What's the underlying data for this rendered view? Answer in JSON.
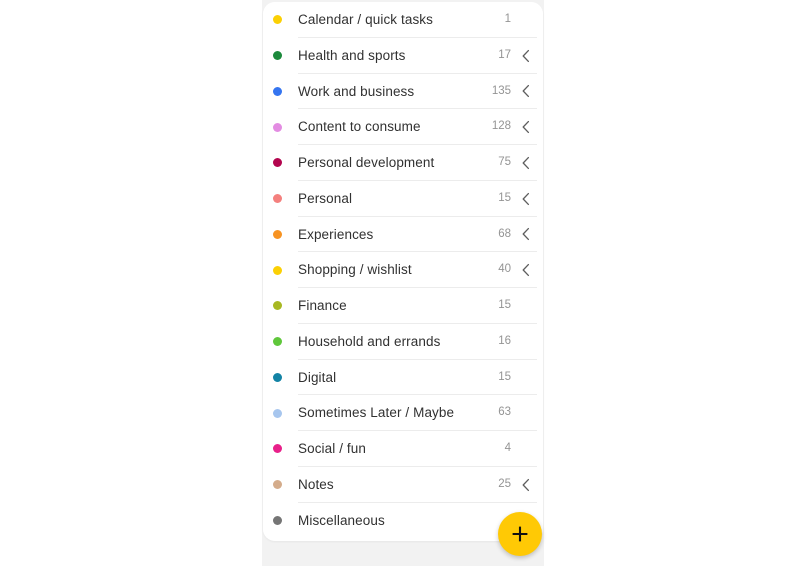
{
  "app": {
    "background_color": "#f2f2f2",
    "card_color": "#ffffff",
    "accent_color": "#FFC905",
    "divider_color": "#ececec",
    "label_color": "#313131",
    "count_color": "#949494"
  },
  "fab": {
    "label": "+",
    "icon": "plus-icon",
    "color": "#FFC905"
  },
  "list": {
    "rows": [
      {
        "label": "Calendar / quick tasks",
        "count": "1",
        "dot_color": "#FBD004",
        "has_chevron": false,
        "chevron_icon": "chevron-left-icon"
      },
      {
        "label": "Health and sports",
        "count": "17",
        "dot_color": "#1C8A3C",
        "has_chevron": true,
        "chevron_icon": "chevron-left-icon"
      },
      {
        "label": "Work and business",
        "count": "135",
        "dot_color": "#3575F0",
        "has_chevron": true,
        "chevron_icon": "chevron-left-icon"
      },
      {
        "label": "Content to consume",
        "count": "128",
        "dot_color": "#E38CE2",
        "has_chevron": true,
        "chevron_icon": "chevron-left-icon"
      },
      {
        "label": "Personal development",
        "count": "75",
        "dot_color": "#B3054E",
        "has_chevron": true,
        "chevron_icon": "chevron-left-icon"
      },
      {
        "label": "Personal",
        "count": "15",
        "dot_color": "#F4807E",
        "has_chevron": true,
        "chevron_icon": "chevron-left-icon"
      },
      {
        "label": "Experiences",
        "count": "68",
        "dot_color": "#F79322",
        "has_chevron": true,
        "chevron_icon": "chevron-left-icon"
      },
      {
        "label": "Shopping / wishlist",
        "count": "40",
        "dot_color": "#FBD004",
        "has_chevron": true,
        "chevron_icon": "chevron-left-icon"
      },
      {
        "label": "Finance",
        "count": "15",
        "dot_color": "#A8B822",
        "has_chevron": false,
        "chevron_icon": "chevron-left-icon"
      },
      {
        "label": "Household and errands",
        "count": "16",
        "dot_color": "#5FC73B",
        "has_chevron": false,
        "chevron_icon": "chevron-left-icon"
      },
      {
        "label": "Digital",
        "count": "15",
        "dot_color": "#1383A5",
        "has_chevron": false,
        "chevron_icon": "chevron-left-icon"
      },
      {
        "label": "Sometimes Later / Maybe",
        "count": "63",
        "dot_color": "#A7C6EE",
        "has_chevron": false,
        "chevron_icon": "chevron-left-icon"
      },
      {
        "label": "Social / fun",
        "count": "4",
        "dot_color": "#E8208A",
        "has_chevron": false,
        "chevron_icon": "chevron-left-icon"
      },
      {
        "label": "Notes",
        "count": "25",
        "dot_color": "#D4AC8B",
        "has_chevron": true,
        "chevron_icon": "chevron-left-icon"
      },
      {
        "label": "Miscellaneous",
        "count": "",
        "dot_color": "#757575",
        "has_chevron": false,
        "chevron_icon": "chevron-left-icon"
      }
    ]
  }
}
